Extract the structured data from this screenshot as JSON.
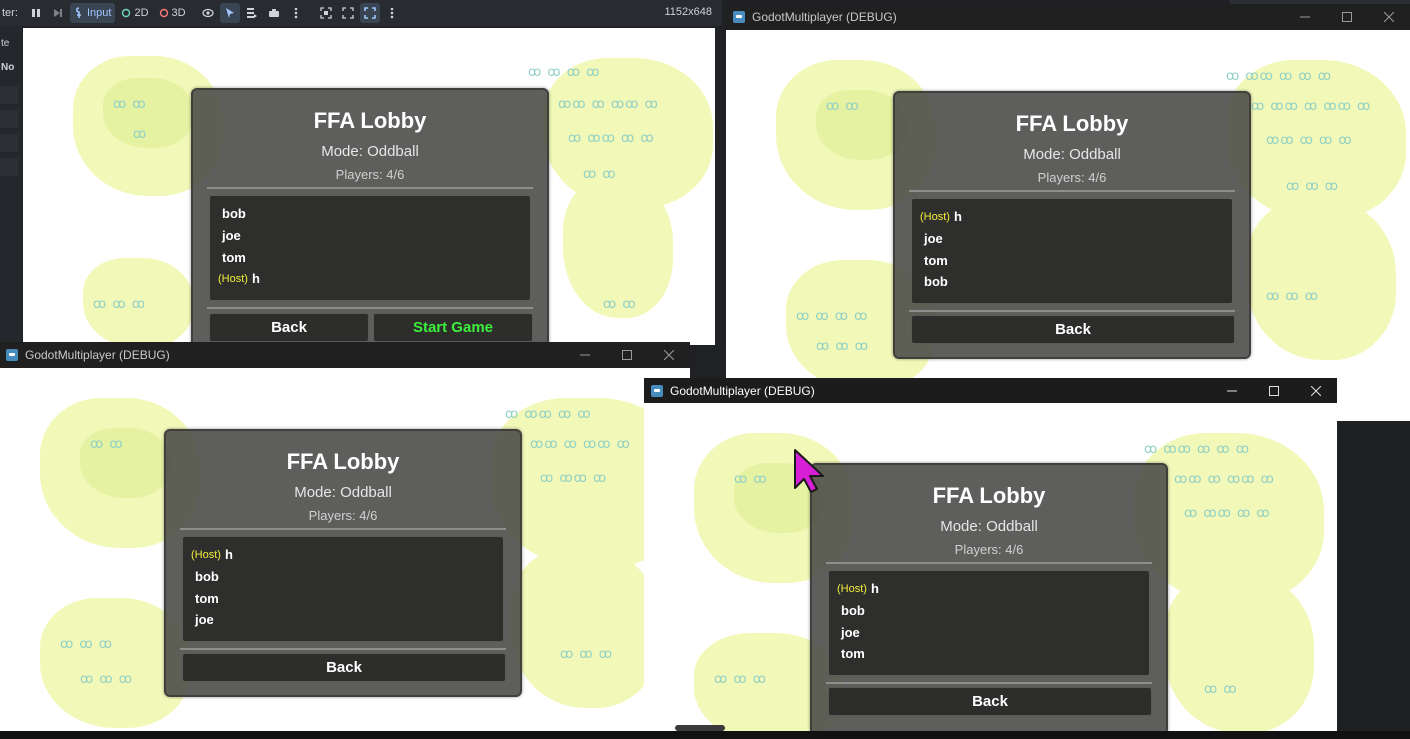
{
  "editor": {
    "left_clip_text": "ter:",
    "side_labels": [
      "te",
      "No"
    ],
    "toolbar": {
      "input_label": "Input",
      "mode_2d_label": "2D",
      "mode_3d_label": "3D",
      "resolution": "1152x648"
    }
  },
  "windows": [
    {
      "id": "editor-viewport",
      "title": "",
      "lobby": {
        "title": "FFA Lobby",
        "mode": "Mode: Oddball",
        "players": "Players: 4/6",
        "player_list": [
          {
            "host_tag": "",
            "name": "bob"
          },
          {
            "host_tag": "",
            "name": "joe"
          },
          {
            "host_tag": "",
            "name": "tom"
          },
          {
            "host_tag": "(Host)",
            "name": "h"
          }
        ],
        "back_label": "Back",
        "start_label": "Start Game"
      }
    },
    {
      "id": "win-top-right",
      "title": "GodotMultiplayer (DEBUG)",
      "lobby": {
        "title": "FFA Lobby",
        "mode": "Mode: Oddball",
        "players": "Players: 4/6",
        "player_list": [
          {
            "host_tag": "(Host)",
            "name": "h"
          },
          {
            "host_tag": "",
            "name": "joe"
          },
          {
            "host_tag": "",
            "name": "tom"
          },
          {
            "host_tag": "",
            "name": "bob"
          }
        ],
        "back_label": "Back"
      }
    },
    {
      "id": "win-bottom-left",
      "title": "GodotMultiplayer (DEBUG)",
      "lobby": {
        "title": "FFA Lobby",
        "mode": "Mode: Oddball",
        "players": "Players: 4/6",
        "player_list": [
          {
            "host_tag": "(Host)",
            "name": "h"
          },
          {
            "host_tag": "",
            "name": "bob"
          },
          {
            "host_tag": "",
            "name": "tom"
          },
          {
            "host_tag": "",
            "name": "joe"
          }
        ],
        "back_label": "Back"
      }
    },
    {
      "id": "win-bottom-right",
      "title": "GodotMultiplayer (DEBUG)",
      "lobby": {
        "title": "FFA Lobby",
        "mode": "Mode: Oddball",
        "players": "Players: 4/6",
        "player_list": [
          {
            "host_tag": "(Host)",
            "name": "h"
          },
          {
            "host_tag": "",
            "name": "bob"
          },
          {
            "host_tag": "",
            "name": "joe"
          },
          {
            "host_tag": "",
            "name": "tom"
          }
        ],
        "back_label": "Back"
      }
    }
  ],
  "colors": {
    "host_tag": "#f3ee3b",
    "start_game": "#3cf03c",
    "panel_bg": "#484846",
    "map_grass": "#f2f8b8",
    "bush": "#91d0c5",
    "titlebar": "#202020",
    "cursor": "#d61fd6"
  },
  "icons": [
    "pause-icon",
    "step-icon",
    "input-icon",
    "select-icon",
    "visibility-icon",
    "minimize-icon",
    "maximize-icon",
    "close-icon",
    "godot-icon",
    "cursor-icon"
  ]
}
